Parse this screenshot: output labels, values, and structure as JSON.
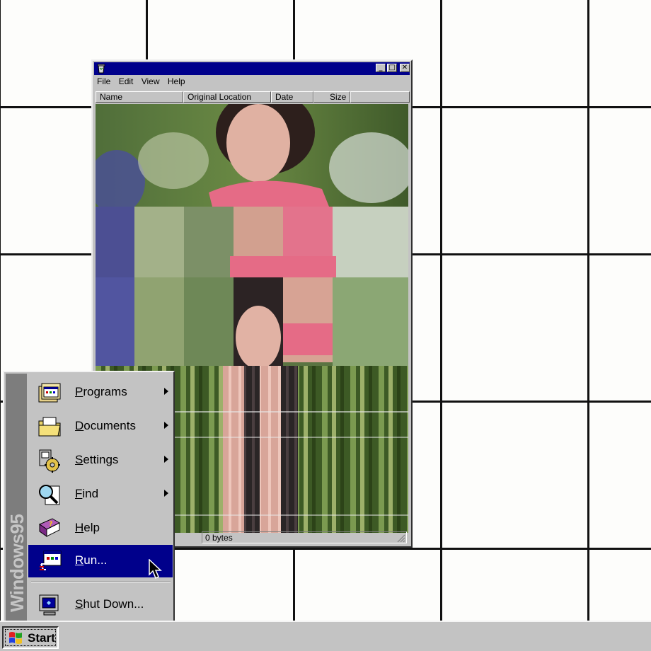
{
  "window": {
    "menu": [
      "File",
      "Edit",
      "View",
      "Help"
    ],
    "columns": [
      "Name",
      "Original Location",
      "Date",
      "Size"
    ],
    "status_text": "0 bytes",
    "controls": {
      "minimize": "_",
      "maximize": "□",
      "close": "✕"
    }
  },
  "start_menu": {
    "banner": "Windows95",
    "items": [
      {
        "label": "Programs",
        "icon": "programs-icon",
        "submenu": true
      },
      {
        "label": "Documents",
        "icon": "documents-folder-icon",
        "submenu": true
      },
      {
        "label": "Settings",
        "icon": "settings-icon",
        "submenu": true
      },
      {
        "label": "Find",
        "icon": "find-magnifier-icon",
        "submenu": true
      },
      {
        "label": "Help",
        "icon": "help-book-icon",
        "submenu": false
      },
      {
        "label": "Run...",
        "icon": "run-icon",
        "submenu": false,
        "selected": true
      },
      {
        "label": "Shut Down...",
        "icon": "shutdown-computer-icon",
        "submenu": false
      }
    ]
  },
  "taskbar": {
    "start_label": "Start"
  },
  "colors": {
    "selection": "#00008b",
    "chrome": "#c3c3c3",
    "banner": "#7d7d7d"
  }
}
